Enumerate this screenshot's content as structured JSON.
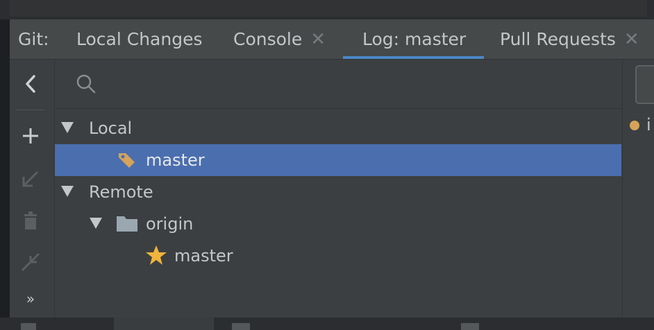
{
  "tabs": {
    "prefix": "Git:",
    "items": [
      {
        "label": "Local Changes",
        "closable": false,
        "active": false
      },
      {
        "label": "Console",
        "closable": true,
        "active": false
      },
      {
        "label": "Log: master",
        "closable": false,
        "active": true
      },
      {
        "label": "Pull Requests",
        "closable": true,
        "active": false
      }
    ],
    "close_glyph": "✕"
  },
  "sidebar": {
    "collapse_glyph": "‹",
    "more_glyph": "»",
    "icons": [
      "chevron-left-icon",
      "plus-icon",
      "checkout-arrow-icon",
      "trash-icon",
      "merge-icon",
      "more-icon"
    ]
  },
  "branches": {
    "local": {
      "label": "Local",
      "items": [
        {
          "label": "master",
          "selected": true,
          "icon": "tag-icon"
        }
      ]
    },
    "remote": {
      "label": "Remote",
      "folder": {
        "label": "origin",
        "items": [
          {
            "label": "master",
            "icon": "star-icon"
          }
        ]
      }
    }
  },
  "log": {
    "first_commit_fragment": "i"
  },
  "colors": {
    "accent": "#4a88c7",
    "selection": "#4b6eaf",
    "tag": "#d6a35a",
    "star": "#f0b43c",
    "panel": "#3c3f41"
  }
}
